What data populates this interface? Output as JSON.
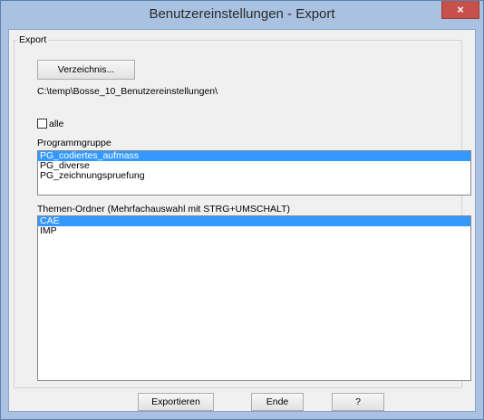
{
  "window": {
    "title": "Benutzereinstellungen - Export",
    "close_glyph": "×"
  },
  "export_group": {
    "legend": "Export",
    "directory_button": "Verzeichnis...",
    "path": "C:\\temp\\Bosse_10_Benutzereinstellungen\\",
    "all_checkbox": {
      "label": "alle",
      "checked": false
    }
  },
  "program_group": {
    "label": "Programmgruppe",
    "items": [
      {
        "label": "PG_codiertes_aufmass",
        "selected": true
      },
      {
        "label": "PG_diverse",
        "selected": false
      },
      {
        "label": "PG_zeichnungspruefung",
        "selected": false
      }
    ]
  },
  "theme_folder": {
    "label": "Themen-Ordner (Mehrfachauswahl mit STRG+UMSCHALT)",
    "items": [
      {
        "label": "CAE",
        "selected": true
      },
      {
        "label": "IMP",
        "selected": false
      }
    ]
  },
  "buttons": {
    "export": "Exportieren",
    "end": "Ende",
    "help": "?"
  },
  "colors": {
    "selection": "#3399ff",
    "title_bar": "#a9c2e2",
    "close_button": "#c7504a"
  }
}
